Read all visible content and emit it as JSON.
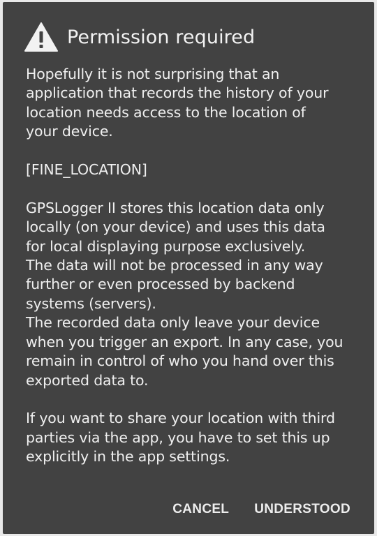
{
  "dialog": {
    "title": "Permission required",
    "icon": "warning-icon",
    "message": "Hopefully it is not surprising that an\napplication that records the history of your\nlocation needs access to the location of\nyour device.\n\n[FINE_LOCATION]\n\nGPSLogger II stores this location data only\nlocally (on your device) and uses this data\nfor local displaying purpose exclusively.\nThe data will not be processed in any way\nfurther or even processed by backend\nsystems (servers).\nThe recorded data only leave your device\nwhen you trigger an export. In any case, you\nremain in control of who you hand over this\nexported data to.\n\nIf you want to share your location with third\nparties via the app, you have to set this up\nexplicitly in the app settings.",
    "cancel_label": "CANCEL",
    "confirm_label": "UNDERSTOOD"
  },
  "colors": {
    "dialog_background": "#424242",
    "text": "#efefef",
    "page_background": "#e9e9e9"
  }
}
